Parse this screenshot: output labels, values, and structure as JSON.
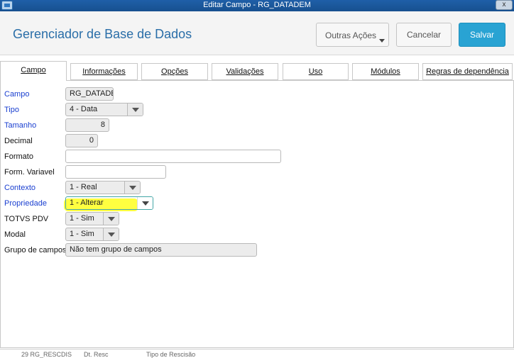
{
  "window": {
    "title": "Editar Campo - RG_DATADEM",
    "close_label": "x"
  },
  "header": {
    "page_title": "Gerenciador de Base de Dados",
    "buttons": {
      "outras": "Outras Ações",
      "cancelar": "Cancelar",
      "salvar": "Salvar"
    },
    "accent_color": "#29a3d3"
  },
  "tabs": [
    {
      "label": "Campo",
      "active": true
    },
    {
      "label": "Informações"
    },
    {
      "label": "Opções"
    },
    {
      "label": "Validações"
    },
    {
      "label": "Uso"
    },
    {
      "label": "Módulos"
    },
    {
      "label": "Regras de dependência"
    }
  ],
  "form": {
    "campo": {
      "label": "Campo",
      "value": "RG_DATADEM"
    },
    "tipo": {
      "label": "Tipo",
      "value": "4 - Data"
    },
    "tamanho": {
      "label": "Tamanho",
      "value": "8"
    },
    "decimal": {
      "label": "Decimal",
      "value": "0"
    },
    "formato": {
      "label": "Formato",
      "value": ""
    },
    "form_variavel": {
      "label": "Form. Variavel",
      "value": ""
    },
    "contexto": {
      "label": "Contexto",
      "value": "1 - Real"
    },
    "propriedade": {
      "label": "Propriedade",
      "value": "1 - Alterar"
    },
    "totvs_pdv": {
      "label": "TOTVS PDV",
      "value": "1 - Sim"
    },
    "modal": {
      "label": "Modal",
      "value": "1 - Sim"
    },
    "grupo_campos": {
      "label": "Grupo de campos",
      "value": "Não tem grupo de campos"
    }
  },
  "background_fragment": {
    "col1": "29 RG_RESCDIS",
    "col2": "Dt. Resc",
    "col3": "Tipo de Rescisão"
  }
}
